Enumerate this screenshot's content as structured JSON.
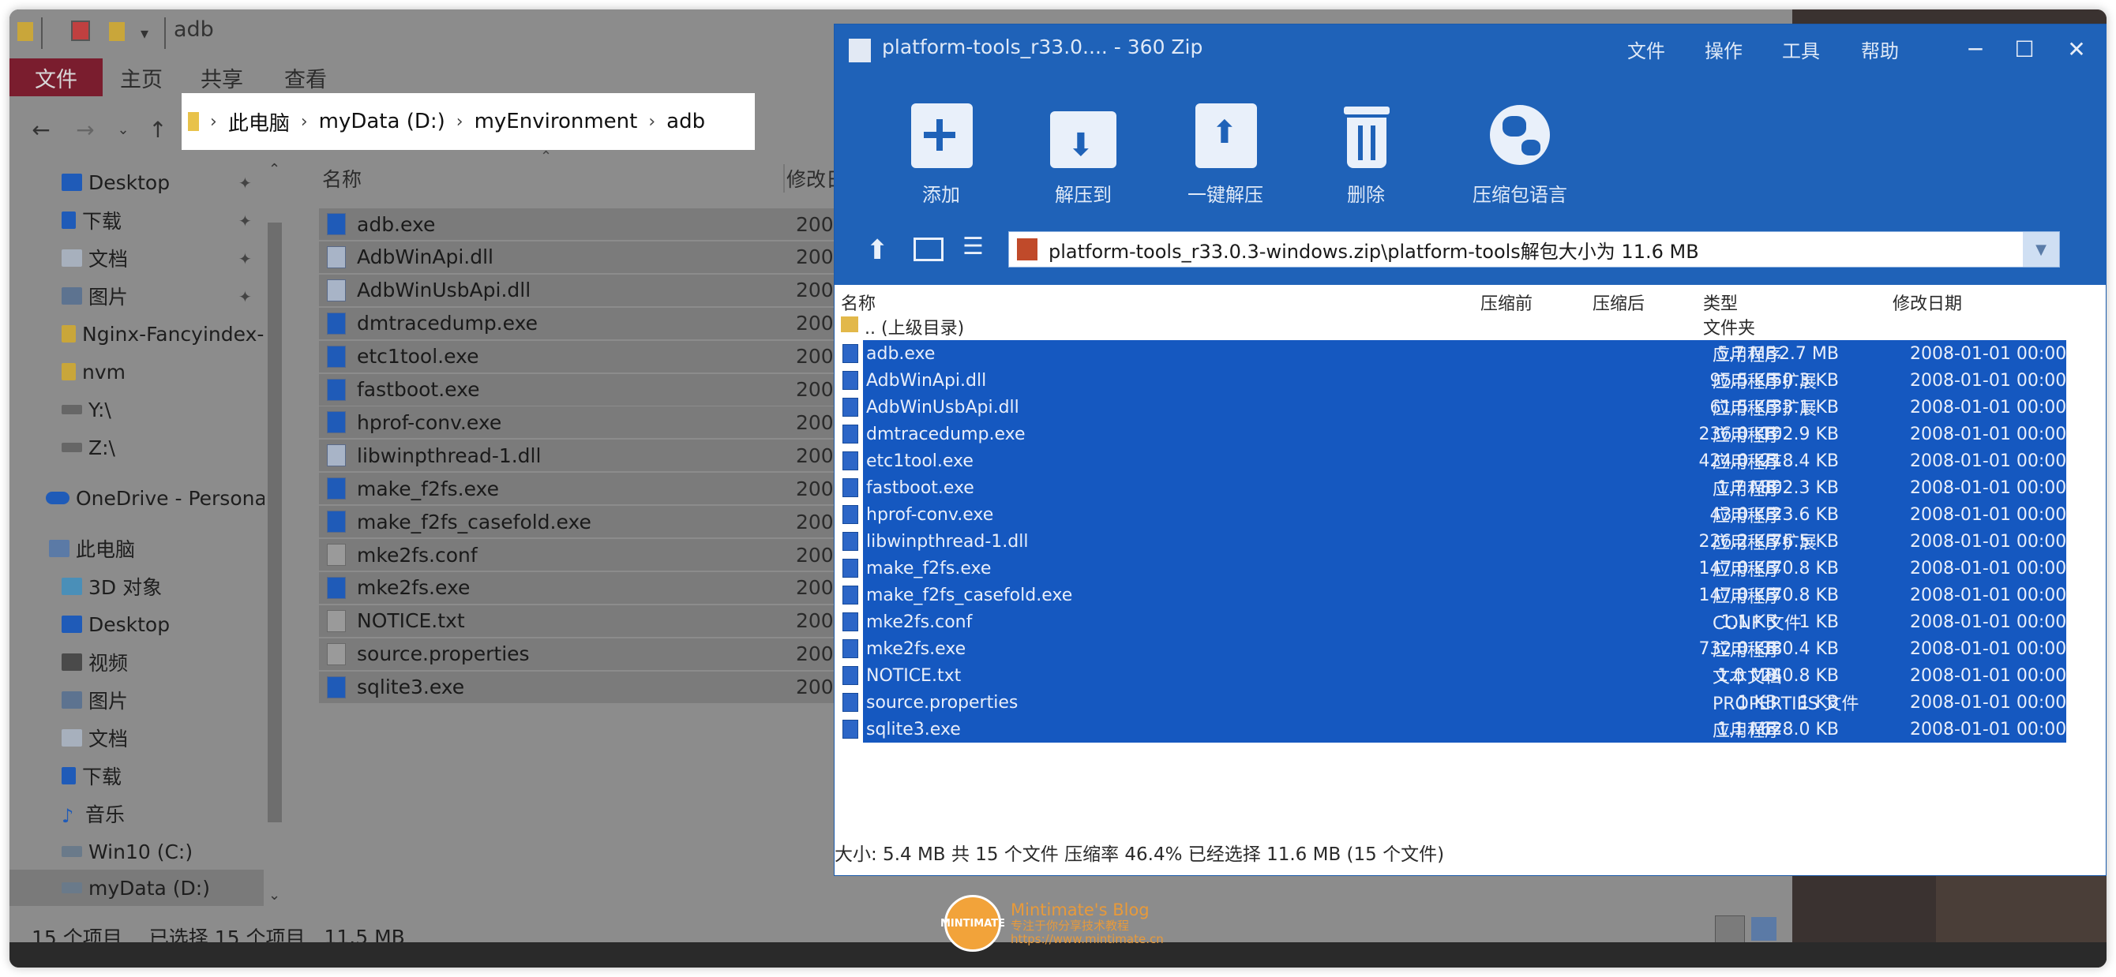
{
  "explorer": {
    "title": "adb",
    "ribbon_tabs": [
      "文件",
      "主页",
      "共享",
      "查看"
    ],
    "breadcrumb": [
      "此电脑",
      "myData (D:)",
      "myEnvironment",
      "adb"
    ],
    "sidebar": [
      {
        "label": "Desktop",
        "pinned": true,
        "icon": "desktop-icon"
      },
      {
        "label": "下载",
        "pinned": true,
        "icon": "download-icon"
      },
      {
        "label": "文档",
        "pinned": true,
        "icon": "document-icon"
      },
      {
        "label": "图片",
        "pinned": true,
        "icon": "picture-icon"
      },
      {
        "label": "Nginx-Fancyindex-",
        "pinned": false,
        "icon": "folder-icon"
      },
      {
        "label": "nvm",
        "pinned": false,
        "icon": "folder-icon"
      },
      {
        "label": "Y:\\",
        "pinned": false,
        "icon": "network-drive-icon"
      },
      {
        "label": "Z:\\",
        "pinned": false,
        "icon": "network-drive-icon"
      },
      {
        "label": "OneDrive - Personal",
        "pinned": false,
        "icon": "cloud-icon"
      },
      {
        "label": "此电脑",
        "pinned": false,
        "icon": "computer-icon"
      },
      {
        "label": "3D 对象",
        "pinned": false,
        "icon": "cube-icon"
      },
      {
        "label": "Desktop",
        "pinned": false,
        "icon": "desktop-icon"
      },
      {
        "label": "视频",
        "pinned": false,
        "icon": "video-icon"
      },
      {
        "label": "图片",
        "pinned": false,
        "icon": "picture-icon"
      },
      {
        "label": "文档",
        "pinned": false,
        "icon": "document-icon"
      },
      {
        "label": "下载",
        "pinned": false,
        "icon": "download-icon"
      },
      {
        "label": "音乐",
        "pinned": false,
        "icon": "music-icon"
      },
      {
        "label": "Win10 (C:)",
        "pinned": false,
        "icon": "drive-icon"
      },
      {
        "label": "myData (D:)",
        "pinned": false,
        "icon": "drive-icon"
      }
    ],
    "col_name": "名称",
    "col_date": "修改日",
    "files": [
      {
        "name": "adb.exe",
        "date": "2008,",
        "icon": "exe"
      },
      {
        "name": "AdbWinApi.dll",
        "date": "2008,",
        "icon": "dll"
      },
      {
        "name": "AdbWinUsbApi.dll",
        "date": "2008,",
        "icon": "dll"
      },
      {
        "name": "dmtracedump.exe",
        "date": "2008,",
        "icon": "exe"
      },
      {
        "name": "etc1tool.exe",
        "date": "2008,",
        "icon": "exe"
      },
      {
        "name": "fastboot.exe",
        "date": "2008,",
        "icon": "exe"
      },
      {
        "name": "hprof-conv.exe",
        "date": "2008,",
        "icon": "exe"
      },
      {
        "name": "libwinpthread-1.dll",
        "date": "2008,",
        "icon": "dll"
      },
      {
        "name": "make_f2fs.exe",
        "date": "2008,",
        "icon": "exe"
      },
      {
        "name": "make_f2fs_casefold.exe",
        "date": "2008,",
        "icon": "exe"
      },
      {
        "name": "mke2fs.conf",
        "date": "2008,",
        "icon": "blank"
      },
      {
        "name": "mke2fs.exe",
        "date": "2008,",
        "icon": "exe"
      },
      {
        "name": "NOTICE.txt",
        "date": "2008,",
        "icon": "blank"
      },
      {
        "name": "source.properties",
        "date": "2008,",
        "icon": "blank"
      },
      {
        "name": "sqlite3.exe",
        "date": "2008,",
        "icon": "exe"
      }
    ],
    "status": {
      "count": "15 个项目",
      "selected": "已选择 15 个项目",
      "size": "11.5 MB"
    }
  },
  "zip": {
    "title": "platform-tools_r33.0.... - 360 Zip",
    "menu": [
      "文件",
      "操作",
      "工具",
      "帮助"
    ],
    "tools": [
      {
        "label": "添加",
        "icon": "add-archive-icon"
      },
      {
        "label": "解压到",
        "icon": "extract-to-icon"
      },
      {
        "label": "一键解压",
        "icon": "one-click-extract-icon"
      },
      {
        "label": "删除",
        "icon": "delete-icon"
      },
      {
        "label": "压缩包语言",
        "icon": "globe-icon"
      }
    ],
    "path": "platform-tools_r33.0.3-windows.zip\\platform-tools解包大小为 11.6 MB",
    "headers": {
      "name": "名称",
      "before": "压缩前",
      "after": "压缩后",
      "type": "类型",
      "date": "修改日期"
    },
    "parent": {
      "name": ".. (上级目录)",
      "type": "文件夹"
    },
    "rows": [
      {
        "name": "adb.exe",
        "before": "5.7 MB",
        "after": "2.7 MB",
        "type": "应用程序",
        "date": "2008-01-01 00:00"
      },
      {
        "name": "AdbWinApi.dll",
        "before": "95.5 KB",
        "after": "50.3 KB",
        "type": "应用程序扩展",
        "date": "2008-01-01 00:00"
      },
      {
        "name": "AdbWinUsbApi.dll",
        "before": "61.5 KB",
        "after": "33.1 KB",
        "type": "应用程序扩展",
        "date": "2008-01-01 00:00"
      },
      {
        "name": "dmtracedump.exe",
        "before": "236.0 KB",
        "after": "102.9 KB",
        "type": "应用程序",
        "date": "2008-01-01 00:00"
      },
      {
        "name": "etc1tool.exe",
        "before": "424.0 KB",
        "after": "218.4 KB",
        "type": "应用程序",
        "date": "2008-01-01 00:00"
      },
      {
        "name": "fastboot.exe",
        "before": "1.7 MB",
        "after": "802.3 KB",
        "type": "应用程序",
        "date": "2008-01-01 00:00"
      },
      {
        "name": "hprof-conv.exe",
        "before": "43.0 KB",
        "after": "23.6 KB",
        "type": "应用程序",
        "date": "2008-01-01 00:00"
      },
      {
        "name": "libwinpthread-1.dll",
        "before": "226.2 KB",
        "after": "76.5 KB",
        "type": "应用程序扩展",
        "date": "2008-01-01 00:00"
      },
      {
        "name": "make_f2fs.exe",
        "before": "147.0 KB",
        "after": "70.8 KB",
        "type": "应用程序",
        "date": "2008-01-01 00:00"
      },
      {
        "name": "make_f2fs_casefold.exe",
        "before": "147.0 KB",
        "after": "70.8 KB",
        "type": "应用程序",
        "date": "2008-01-01 00:00"
      },
      {
        "name": "mke2fs.conf",
        "before": "1.1 KB",
        "after": "1 KB",
        "type": "CONF 文件",
        "date": "2008-01-01 00:00"
      },
      {
        "name": "mke2fs.exe",
        "before": "732.0 KB",
        "after": "380.4 KB",
        "type": "应用程序",
        "date": "2008-01-01 00:00"
      },
      {
        "name": "NOTICE.txt",
        "before": "1.0 MB",
        "after": "240.8 KB",
        "type": "文本文档",
        "date": "2008-01-01 00:00"
      },
      {
        "name": "source.properties",
        "before": "1 KB",
        "after": "1 KB",
        "type": "PROPERTIES 文件",
        "date": "2008-01-01 00:00"
      },
      {
        "name": "sqlite3.exe",
        "before": "1.1 MB",
        "after": "628.0 KB",
        "type": "应用程序",
        "date": "2008-01-01 00:00"
      }
    ],
    "status": "大小: 5.4 MB 共 15 个文件 压缩率 46.4% 已经选择 11.6 MB (15 个文件)"
  },
  "watermark": {
    "title": "Mintimate's Blog",
    "subtitle": "专注于你分享技术教程",
    "url": "https://www.mintimate.cn",
    "badge": "MINTIMATE"
  },
  "colors": {
    "zip_blue": "#1f62b8",
    "selection_blue": "#1558c0",
    "file_tab": "#7a1d2e",
    "accent_orange": "#f2a33a"
  }
}
